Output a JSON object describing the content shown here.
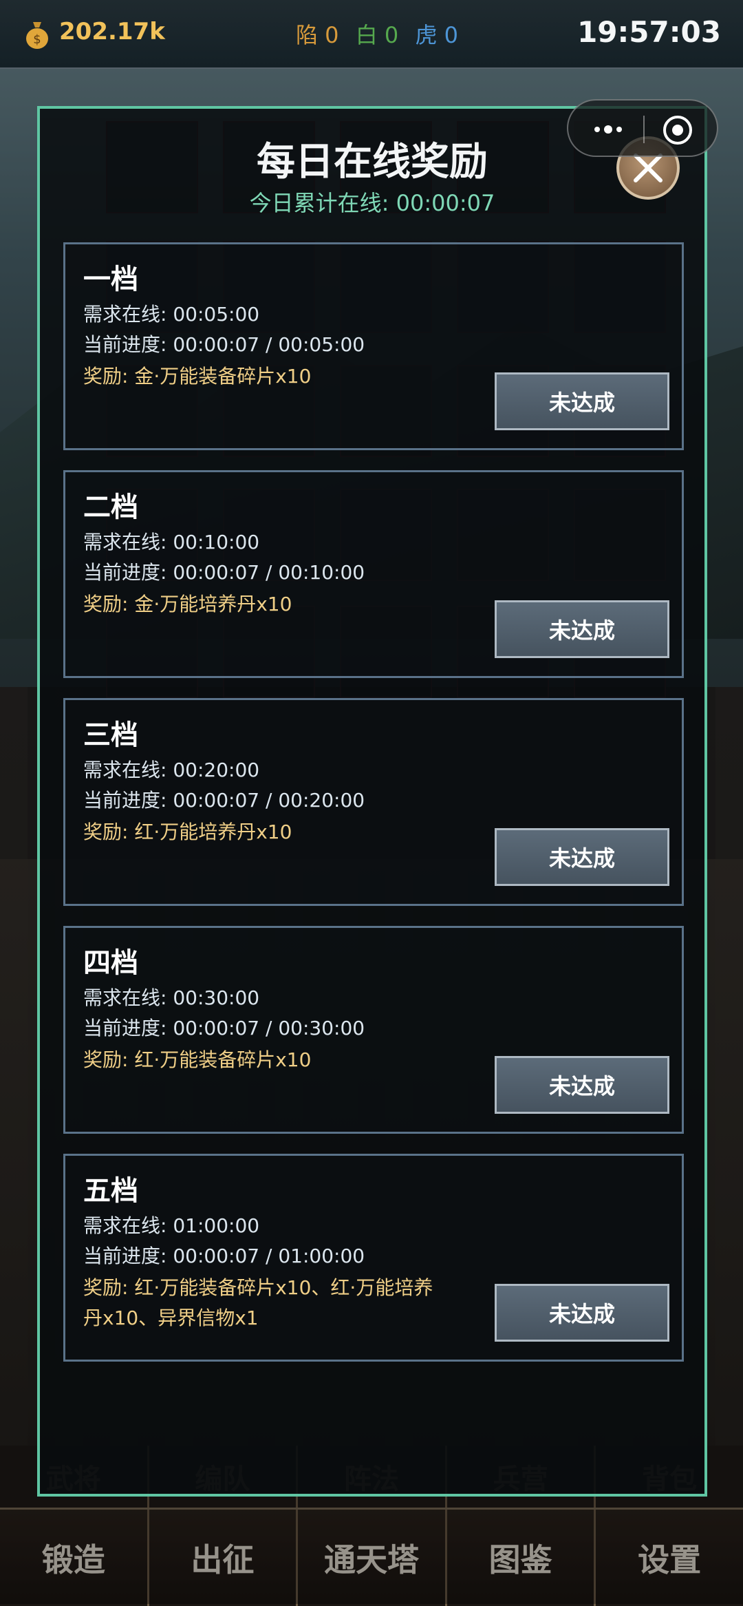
{
  "topbar": {
    "coins": "202.17k",
    "tags": [
      {
        "label": "陷 0",
        "color": "#d79a3b"
      },
      {
        "label": "白 0",
        "color": "#56a94e"
      },
      {
        "label": "虎 0",
        "color": "#4d95d6"
      }
    ],
    "time": "19:57:03"
  },
  "modal": {
    "title": "每日在线奖励",
    "subtitle": "今日累计在线: 00:00:07",
    "tiers": [
      {
        "title": "一档",
        "required": "需求在线: 00:05:00",
        "progress": "当前进度: 00:00:07 / 00:05:00",
        "reward": "奖励: 金·万能装备碎片x10",
        "button": "未达成"
      },
      {
        "title": "二档",
        "required": "需求在线: 00:10:00",
        "progress": "当前进度: 00:00:07 / 00:10:00",
        "reward": "奖励: 金·万能培养丹x10",
        "button": "未达成"
      },
      {
        "title": "三档",
        "required": "需求在线: 00:20:00",
        "progress": "当前进度: 00:00:07 / 00:20:00",
        "reward": "奖励: 红·万能培养丹x10",
        "button": "未达成"
      },
      {
        "title": "四档",
        "required": "需求在线: 00:30:00",
        "progress": "当前进度: 00:00:07 / 00:30:00",
        "reward": "奖励: 红·万能装备碎片x10",
        "button": "未达成"
      },
      {
        "title": "五档",
        "required": "需求在线: 01:00:00",
        "progress": "当前进度: 00:00:07 / 01:00:00",
        "reward": "奖励: 红·万能装备碎片x10、红·万能培养丹x10、异界信物x1",
        "button": "未达成"
      }
    ]
  },
  "bottom_tabs_upper": [
    "武将",
    "编队",
    "阵法",
    "兵营",
    "背包"
  ],
  "bottom_tabs_lower": [
    "锻造",
    "出征",
    "通天塔",
    "图鉴",
    "设置"
  ]
}
